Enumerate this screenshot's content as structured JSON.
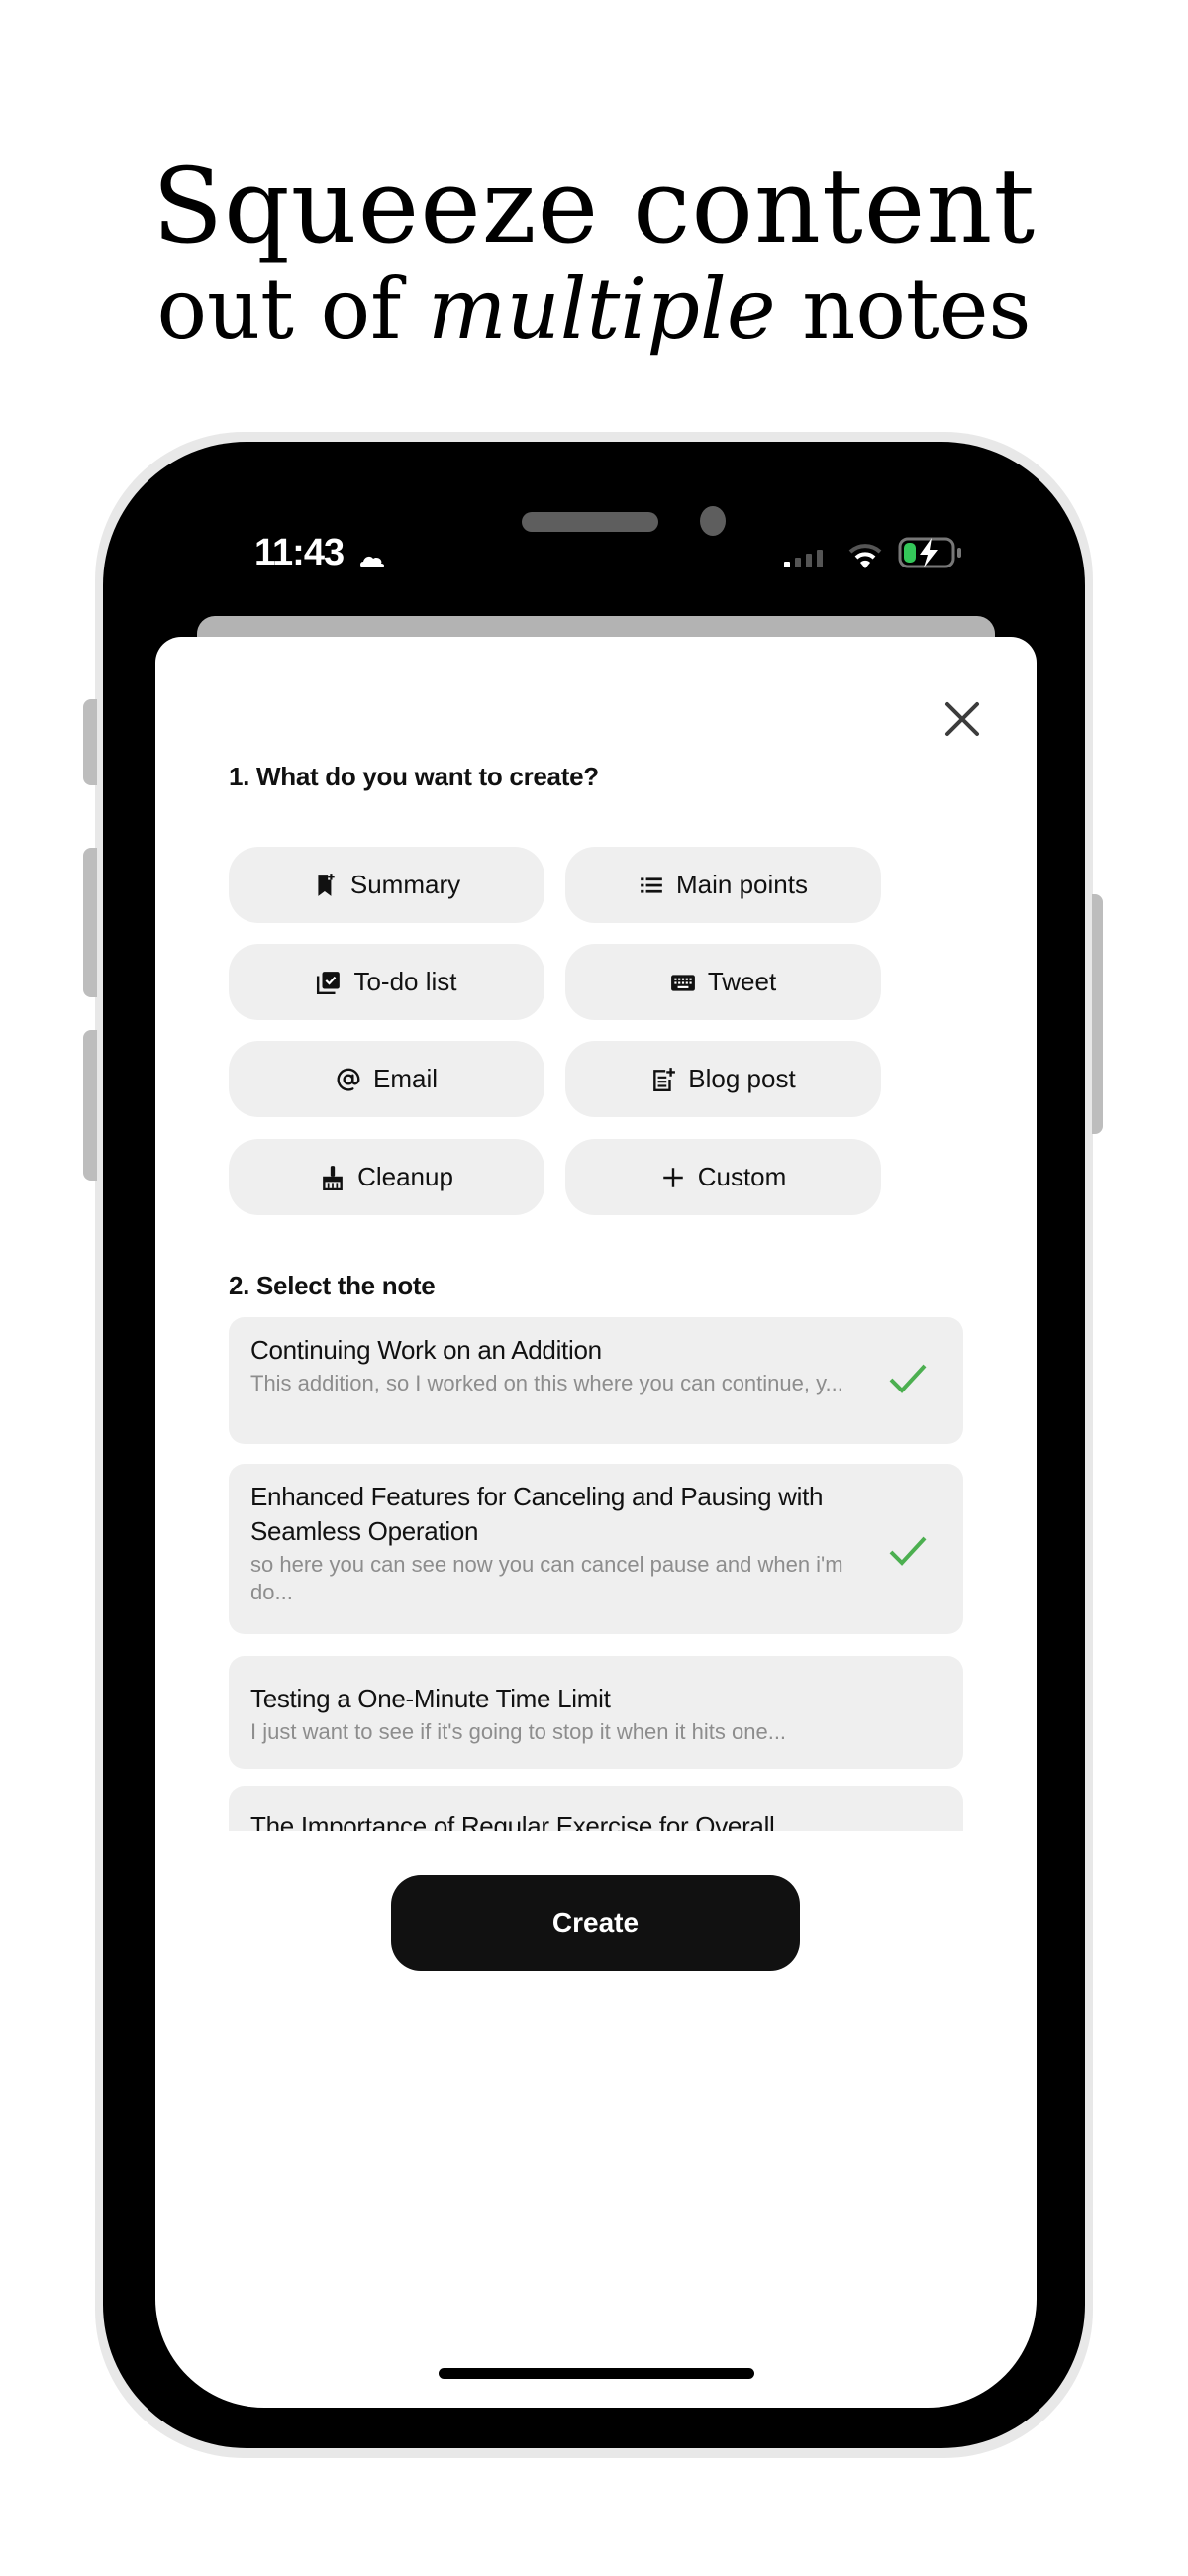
{
  "headline": {
    "line1": "Squeeze content",
    "line2_prefix": "out of ",
    "line2_emphasis": "multiple",
    "line2_suffix": " notes"
  },
  "status_bar": {
    "time": "11:43",
    "icons": [
      "cloud-icon",
      "signal-icon",
      "wifi-icon",
      "battery-charging-icon"
    ],
    "battery_color": "#34c759"
  },
  "modal": {
    "close_icon": "close-icon",
    "section1_title": "1. What do you want to create?",
    "options": [
      {
        "label": "Summary",
        "icon": "bookmark-add-icon"
      },
      {
        "label": "Main points",
        "icon": "list-icon"
      },
      {
        "label": "To-do list",
        "icon": "checklist-icon"
      },
      {
        "label": "Tweet",
        "icon": "keyboard-icon"
      },
      {
        "label": "Email",
        "icon": "at-sign-icon"
      },
      {
        "label": "Blog post",
        "icon": "post-add-icon"
      },
      {
        "label": "Cleanup",
        "icon": "broom-icon"
      },
      {
        "label": "Custom",
        "icon": "plus-icon"
      }
    ],
    "section2_title": "2. Select the note",
    "notes": [
      {
        "title": "Continuing Work on an Addition",
        "preview": "This addition, so I worked on this where you can continue, y...",
        "selected": true
      },
      {
        "title": "Enhanced Features for Canceling and Pausing with Seamless Operation",
        "preview": "so here you can see now you can cancel pause and when i'm do...",
        "selected": true
      },
      {
        "title": "Testing a One-Minute Time Limit",
        "preview": "I just want to see if it's going to stop it when it hits one...",
        "selected": false
      },
      {
        "title": "The Importance of Regular Exercise for Overall",
        "preview": "",
        "selected": false
      }
    ],
    "create_label": "Create",
    "check_color": "#4caf50"
  }
}
